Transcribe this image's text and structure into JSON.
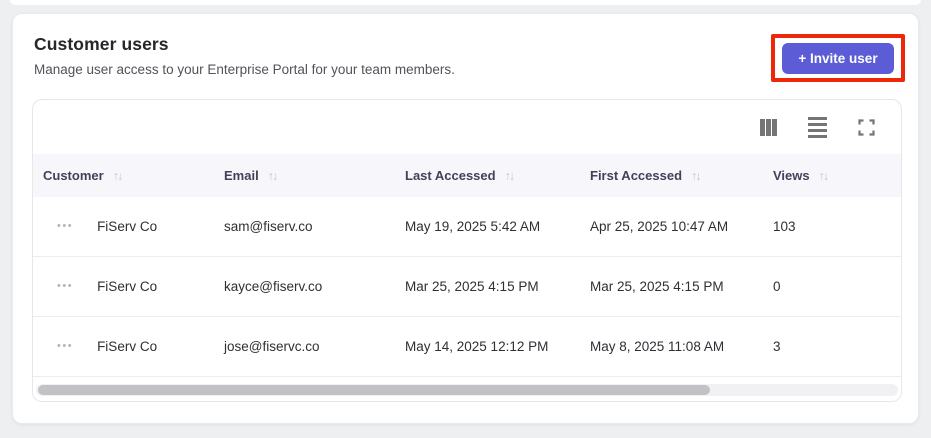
{
  "colors": {
    "accent": "#5b5cd6",
    "highlight_box": "#ee2708",
    "header_row_bg": "#f7f7fb"
  },
  "icons": {
    "sort": "↑↓",
    "row_actions": "•••",
    "toolbar": [
      "columns-icon",
      "row-density-icon",
      "fullscreen-icon"
    ]
  },
  "panel": {
    "title": "Customer users",
    "subtitle": "Manage user access to your Enterprise Portal for your team members.",
    "invite_button_label": "+ Invite user"
  },
  "table": {
    "columns": [
      {
        "label": "Customer"
      },
      {
        "label": "Email"
      },
      {
        "label": "Last Accessed"
      },
      {
        "label": "First Accessed"
      },
      {
        "label": "Views"
      }
    ],
    "rows": [
      {
        "customer": "FiServ Co",
        "email": "sam@fiserv.co",
        "last_accessed": "May 19, 2025 5:42 AM",
        "first_accessed": "Apr 25, 2025 10:47 AM",
        "views": "103"
      },
      {
        "customer": "FiServ Co",
        "email": "kayce@fiserv.co",
        "last_accessed": "Mar 25, 2025 4:15 PM",
        "first_accessed": "Mar 25, 2025 4:15 PM",
        "views": "0"
      },
      {
        "customer": "FiServ Co",
        "email": "jose@fiservc.co",
        "last_accessed": "May 14, 2025 12:12 PM",
        "first_accessed": "May 8, 2025 11:08 AM",
        "views": "3"
      }
    ]
  }
}
